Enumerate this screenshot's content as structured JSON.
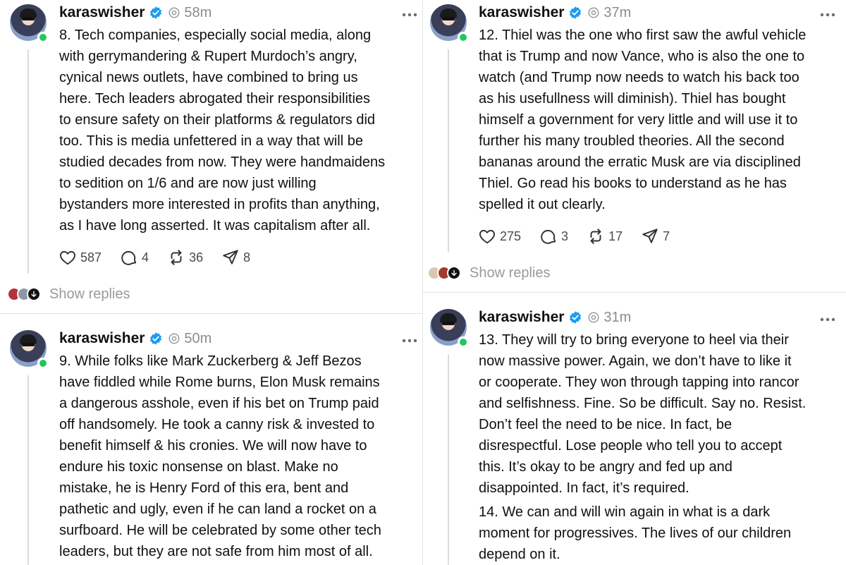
{
  "colors": {
    "verified": "#1d9bf0",
    "online": "#23c55e",
    "muted": "#9a9a9a",
    "line": "#e2e2e2"
  },
  "icons": {
    "like": "heart-icon",
    "reply": "comment-icon",
    "repost": "repost-icon",
    "share": "send-icon",
    "more": "more-dots-icon",
    "verified": "verified-badge-icon"
  },
  "posts": [
    {
      "username": "karaswisher",
      "time": "58m",
      "lines": [
        "8. Tech companies, especially social media, along",
        "with gerrymandering & Rupert Murdoch’s angry,",
        "cynical news outlets, have combined to bring us",
        "here. Tech leaders abrogated their responsibilities",
        "to ensure safety on their platforms & regulators did",
        "too. This is media unfettered in a way that will be",
        "studied decades from now. They were handmaidens",
        "to sedition on 1/6 and are now just willing",
        "bystanders more interested in profits than anything,",
        "as I have long asserted. It was capitalism after all."
      ],
      "likes": "587",
      "replies": "4",
      "reposts": "36",
      "shares": "8",
      "show_replies": "Show replies"
    },
    {
      "username": "karaswisher",
      "time": "50m",
      "lines": [
        "9. While folks like Mark Zuckerberg & Jeff Bezos",
        "have fiddled while Rome burns, Elon Musk remains",
        "a dangerous asshole, even if his bet on Trump paid",
        "off handsomely. He took a canny risk & invested to",
        "benefit himself & his cronies. We will now have to",
        "endure his toxic nonsense on blast. Make no",
        "mistake, he is Henry Ford of this era, bent and",
        "pathetic and ugly, even if he can land a rocket on a",
        "surfboard. He will be celebrated by some other tech",
        "leaders, but they are not safe from him most of all."
      ]
    },
    {
      "username": "karaswisher",
      "time": "37m",
      "lines": [
        "12. Thiel was the one who first saw the awful vehicle",
        "that is Trump and now Vance, who is also the one to",
        "watch (and Trump now needs to watch his back too",
        "as his usefullness will diminish). Thiel has bought",
        "himself a government for very little and will use it to",
        "further his many troubled theories. All the second",
        "bananas around the erratic Musk are via disciplined",
        "Thiel. Go read his books to understand as he has",
        "spelled it out clearly."
      ],
      "likes": "275",
      "replies": "3",
      "reposts": "17",
      "shares": "7",
      "show_replies": "Show replies"
    },
    {
      "username": "karaswisher",
      "time": "31m",
      "lines": [
        "13. They will try to bring everyone to heel via their",
        "now massive power. Again, we don’t have to like it",
        "or cooperate. They won through tapping into rancor",
        "and selfishness. Fine. So be difficult. Say no. Resist.",
        "Don’t feel the need to be nice. In fact, be",
        "disrespectful. Lose people who tell you to accept",
        "this. It’s okay to be angry and fed up and",
        "disappointed. In fact, it’s required."
      ],
      "lines2": [
        "14. We can and will win again in what is a dark",
        "moment for progressives. The lives of our children",
        "depend on it."
      ]
    }
  ]
}
